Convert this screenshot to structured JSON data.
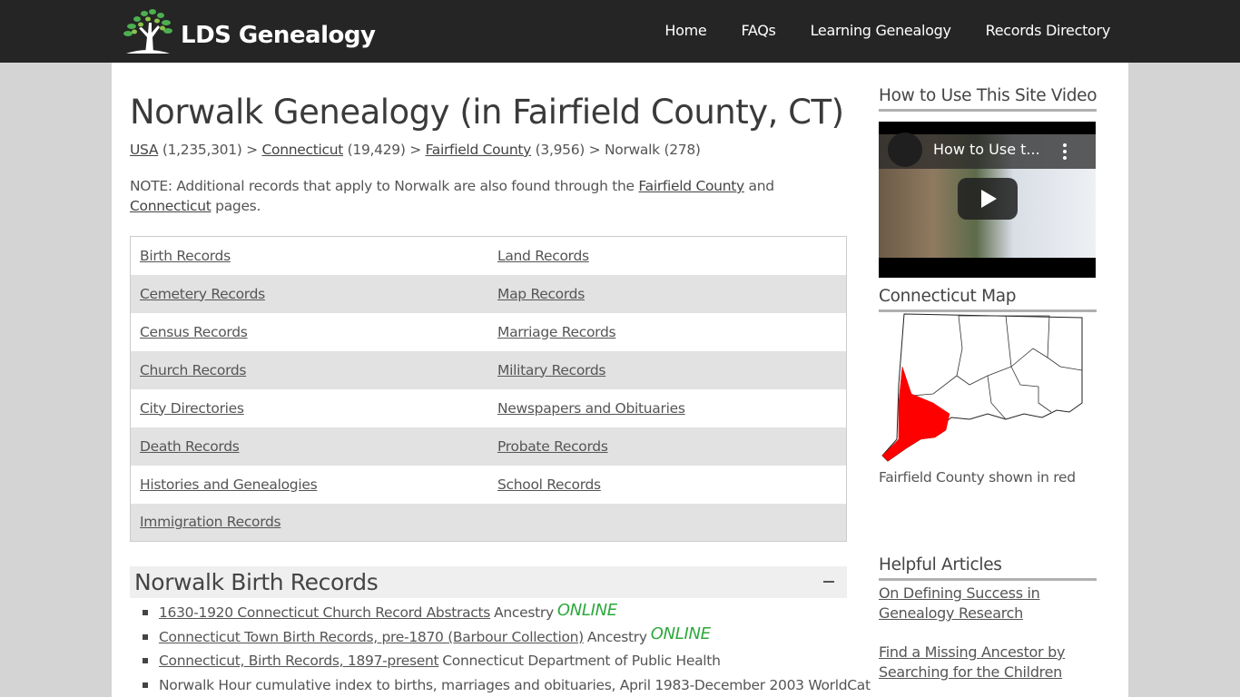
{
  "header": {
    "logo_text": "LDS Genealogy",
    "nav": [
      {
        "label": "Home"
      },
      {
        "label": "FAQs"
      },
      {
        "label": "Learning Genealogy"
      },
      {
        "label": "Records Directory"
      }
    ]
  },
  "main": {
    "title": "Norwalk Genealogy (in Fairfield County, CT)",
    "breadcrumb": [
      {
        "label": "USA",
        "count": "(1,235,301)"
      },
      {
        "label": "Connecticut",
        "count": "(19,429)"
      },
      {
        "label": "Fairfield County",
        "count": "(3,956)"
      },
      {
        "label": "Norwalk",
        "count": "(278)"
      }
    ],
    "breadcrumb_separator": ">",
    "note": {
      "prefix": "NOTE: Additional records that apply to Norwalk are also found through the",
      "link1": "Fairfield County",
      "middle": "and",
      "link2": "Connecticut",
      "suffix": "pages."
    },
    "record_types": [
      [
        "Birth Records",
        "Land Records"
      ],
      [
        "Cemetery Records",
        "Map Records"
      ],
      [
        "Census Records",
        "Marriage Records"
      ],
      [
        "Church Records",
        "Military Records"
      ],
      [
        "City Directories",
        "Newspapers and Obituaries"
      ],
      [
        "Death Records",
        "Probate Records"
      ],
      [
        "Histories and Genealogies",
        "School Records"
      ],
      [
        "Immigration Records",
        ""
      ]
    ],
    "birth_section": {
      "title": "Norwalk Birth Records",
      "collapse_symbol": "−",
      "items": [
        {
          "link": "1630-1920 Connecticut Church Record Abstracts",
          "source": "Ancestry",
          "badge": "ONLINE"
        },
        {
          "link": "Connecticut Town Birth Records, pre-1870 (Barbour Collection)",
          "source": "Ancestry",
          "badge": "ONLINE"
        },
        {
          "link": "Connecticut, Birth Records, 1897-present",
          "source": "Connecticut Department of Public Health",
          "badge": ""
        },
        {
          "link": "",
          "source": "Norwalk Hour cumulative index to births, marriages and obituaries, April 1983-December 2003 WorldCat",
          "badge": ""
        }
      ]
    }
  },
  "sidebar": {
    "video_heading": "How to Use This Site Video",
    "video_title": "How to Use t...",
    "map_heading": "Connecticut Map",
    "map_caption": "Fairfield County shown in red",
    "highlight_color": "#ff0000",
    "articles_heading": "Helpful Articles",
    "articles": [
      {
        "label": "On Defining Success in Genealogy Research"
      },
      {
        "label": "Find a Missing Ancestor by Searching for the Children"
      }
    ]
  },
  "colors": {
    "topbar": "#252525",
    "background": "#d4d4d4",
    "online_badge": "#2ca83c",
    "table_stripe": "#e2e2e2"
  }
}
